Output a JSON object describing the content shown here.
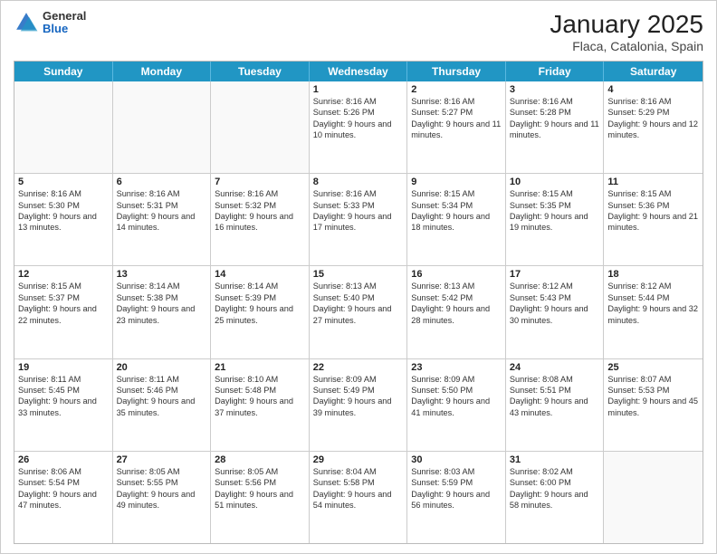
{
  "logo": {
    "general": "General",
    "blue": "Blue"
  },
  "header": {
    "month": "January 2025",
    "location": "Flaca, Catalonia, Spain"
  },
  "days": [
    "Sunday",
    "Monday",
    "Tuesday",
    "Wednesday",
    "Thursday",
    "Friday",
    "Saturday"
  ],
  "weeks": [
    [
      {
        "day": "",
        "sunrise": "",
        "sunset": "",
        "daylight": ""
      },
      {
        "day": "",
        "sunrise": "",
        "sunset": "",
        "daylight": ""
      },
      {
        "day": "",
        "sunrise": "",
        "sunset": "",
        "daylight": ""
      },
      {
        "day": "1",
        "sunrise": "Sunrise: 8:16 AM",
        "sunset": "Sunset: 5:26 PM",
        "daylight": "Daylight: 9 hours and 10 minutes."
      },
      {
        "day": "2",
        "sunrise": "Sunrise: 8:16 AM",
        "sunset": "Sunset: 5:27 PM",
        "daylight": "Daylight: 9 hours and 11 minutes."
      },
      {
        "day": "3",
        "sunrise": "Sunrise: 8:16 AM",
        "sunset": "Sunset: 5:28 PM",
        "daylight": "Daylight: 9 hours and 11 minutes."
      },
      {
        "day": "4",
        "sunrise": "Sunrise: 8:16 AM",
        "sunset": "Sunset: 5:29 PM",
        "daylight": "Daylight: 9 hours and 12 minutes."
      }
    ],
    [
      {
        "day": "5",
        "sunrise": "Sunrise: 8:16 AM",
        "sunset": "Sunset: 5:30 PM",
        "daylight": "Daylight: 9 hours and 13 minutes."
      },
      {
        "day": "6",
        "sunrise": "Sunrise: 8:16 AM",
        "sunset": "Sunset: 5:31 PM",
        "daylight": "Daylight: 9 hours and 14 minutes."
      },
      {
        "day": "7",
        "sunrise": "Sunrise: 8:16 AM",
        "sunset": "Sunset: 5:32 PM",
        "daylight": "Daylight: 9 hours and 16 minutes."
      },
      {
        "day": "8",
        "sunrise": "Sunrise: 8:16 AM",
        "sunset": "Sunset: 5:33 PM",
        "daylight": "Daylight: 9 hours and 17 minutes."
      },
      {
        "day": "9",
        "sunrise": "Sunrise: 8:15 AM",
        "sunset": "Sunset: 5:34 PM",
        "daylight": "Daylight: 9 hours and 18 minutes."
      },
      {
        "day": "10",
        "sunrise": "Sunrise: 8:15 AM",
        "sunset": "Sunset: 5:35 PM",
        "daylight": "Daylight: 9 hours and 19 minutes."
      },
      {
        "day": "11",
        "sunrise": "Sunrise: 8:15 AM",
        "sunset": "Sunset: 5:36 PM",
        "daylight": "Daylight: 9 hours and 21 minutes."
      }
    ],
    [
      {
        "day": "12",
        "sunrise": "Sunrise: 8:15 AM",
        "sunset": "Sunset: 5:37 PM",
        "daylight": "Daylight: 9 hours and 22 minutes."
      },
      {
        "day": "13",
        "sunrise": "Sunrise: 8:14 AM",
        "sunset": "Sunset: 5:38 PM",
        "daylight": "Daylight: 9 hours and 23 minutes."
      },
      {
        "day": "14",
        "sunrise": "Sunrise: 8:14 AM",
        "sunset": "Sunset: 5:39 PM",
        "daylight": "Daylight: 9 hours and 25 minutes."
      },
      {
        "day": "15",
        "sunrise": "Sunrise: 8:13 AM",
        "sunset": "Sunset: 5:40 PM",
        "daylight": "Daylight: 9 hours and 27 minutes."
      },
      {
        "day": "16",
        "sunrise": "Sunrise: 8:13 AM",
        "sunset": "Sunset: 5:42 PM",
        "daylight": "Daylight: 9 hours and 28 minutes."
      },
      {
        "day": "17",
        "sunrise": "Sunrise: 8:12 AM",
        "sunset": "Sunset: 5:43 PM",
        "daylight": "Daylight: 9 hours and 30 minutes."
      },
      {
        "day": "18",
        "sunrise": "Sunrise: 8:12 AM",
        "sunset": "Sunset: 5:44 PM",
        "daylight": "Daylight: 9 hours and 32 minutes."
      }
    ],
    [
      {
        "day": "19",
        "sunrise": "Sunrise: 8:11 AM",
        "sunset": "Sunset: 5:45 PM",
        "daylight": "Daylight: 9 hours and 33 minutes."
      },
      {
        "day": "20",
        "sunrise": "Sunrise: 8:11 AM",
        "sunset": "Sunset: 5:46 PM",
        "daylight": "Daylight: 9 hours and 35 minutes."
      },
      {
        "day": "21",
        "sunrise": "Sunrise: 8:10 AM",
        "sunset": "Sunset: 5:48 PM",
        "daylight": "Daylight: 9 hours and 37 minutes."
      },
      {
        "day": "22",
        "sunrise": "Sunrise: 8:09 AM",
        "sunset": "Sunset: 5:49 PM",
        "daylight": "Daylight: 9 hours and 39 minutes."
      },
      {
        "day": "23",
        "sunrise": "Sunrise: 8:09 AM",
        "sunset": "Sunset: 5:50 PM",
        "daylight": "Daylight: 9 hours and 41 minutes."
      },
      {
        "day": "24",
        "sunrise": "Sunrise: 8:08 AM",
        "sunset": "Sunset: 5:51 PM",
        "daylight": "Daylight: 9 hours and 43 minutes."
      },
      {
        "day": "25",
        "sunrise": "Sunrise: 8:07 AM",
        "sunset": "Sunset: 5:53 PM",
        "daylight": "Daylight: 9 hours and 45 minutes."
      }
    ],
    [
      {
        "day": "26",
        "sunrise": "Sunrise: 8:06 AM",
        "sunset": "Sunset: 5:54 PM",
        "daylight": "Daylight: 9 hours and 47 minutes."
      },
      {
        "day": "27",
        "sunrise": "Sunrise: 8:05 AM",
        "sunset": "Sunset: 5:55 PM",
        "daylight": "Daylight: 9 hours and 49 minutes."
      },
      {
        "day": "28",
        "sunrise": "Sunrise: 8:05 AM",
        "sunset": "Sunset: 5:56 PM",
        "daylight": "Daylight: 9 hours and 51 minutes."
      },
      {
        "day": "29",
        "sunrise": "Sunrise: 8:04 AM",
        "sunset": "Sunset: 5:58 PM",
        "daylight": "Daylight: 9 hours and 54 minutes."
      },
      {
        "day": "30",
        "sunrise": "Sunrise: 8:03 AM",
        "sunset": "Sunset: 5:59 PM",
        "daylight": "Daylight: 9 hours and 56 minutes."
      },
      {
        "day": "31",
        "sunrise": "Sunrise: 8:02 AM",
        "sunset": "Sunset: 6:00 PM",
        "daylight": "Daylight: 9 hours and 58 minutes."
      },
      {
        "day": "",
        "sunrise": "",
        "sunset": "",
        "daylight": ""
      }
    ]
  ]
}
